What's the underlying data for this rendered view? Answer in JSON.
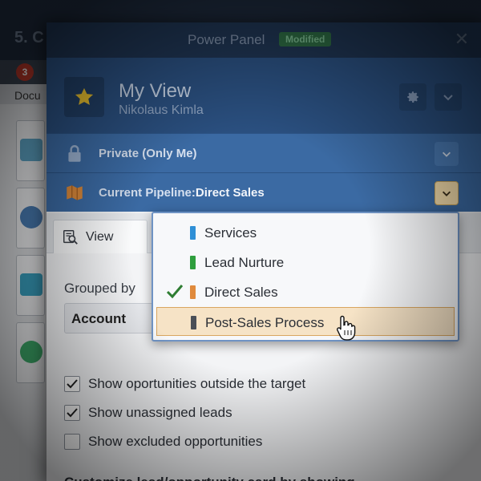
{
  "background_app": {
    "title": "5. C",
    "badge_count": "3",
    "doc_label": "Docu"
  },
  "panel": {
    "title": "Power Panel",
    "modified_badge": "Modified",
    "close_icon": "close-icon",
    "view": {
      "title": "My View",
      "user": "Nikolaus Kimla",
      "star_icon": "star-icon",
      "settings_icon": "gear-icon",
      "expand_icon": "chevron-down-icon"
    },
    "privacy": {
      "label": "Private (Only Me)",
      "icon": "lock-icon"
    },
    "pipeline": {
      "label_prefix": "Current Pipeline:",
      "label_value": "Direct Sales",
      "icon": "pipeline-flag-icon"
    },
    "tab": {
      "label": "View",
      "icon": "view-search-icon"
    },
    "grouped_by": {
      "label": "Grouped by",
      "value": "Account"
    },
    "options": [
      {
        "label": "Show oportunities outside the target",
        "checked": true
      },
      {
        "label": "Show unassigned leads",
        "checked": true
      },
      {
        "label": "Show excluded opportunities",
        "checked": false
      }
    ],
    "customize_label": "Customize lead/opportunity card by showing"
  },
  "pipeline_dropdown": {
    "items": [
      {
        "label": "Services",
        "color": "#2f8fd6",
        "selected": false,
        "hovered": false
      },
      {
        "label": "Lead Nurture",
        "color": "#2e9e3d",
        "selected": false,
        "hovered": false
      },
      {
        "label": "Direct Sales",
        "color": "#e08a3c",
        "selected": true,
        "hovered": false
      },
      {
        "label": "Post-Sales Process",
        "color": "#4a4f57",
        "selected": false,
        "hovered": true
      }
    ]
  },
  "colors": {
    "panel_header": "#2a4f7f",
    "row_bar": "#3b6aa3",
    "highlight": "#f6e3c6",
    "check_green": "#2e7d32"
  }
}
